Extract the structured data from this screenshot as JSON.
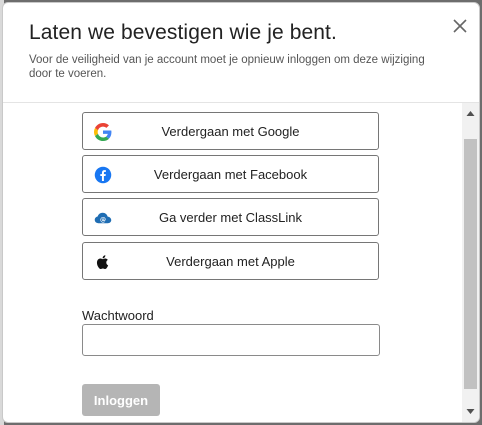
{
  "dialog": {
    "title": "Laten we bevestigen wie je bent.",
    "subtitle": "Voor de veiligheid van je account moet je opnieuw inloggen om deze wijziging door te voeren."
  },
  "providers": [
    {
      "label": "Verdergaan met Google",
      "icon": "google-icon"
    },
    {
      "label": "Verdergaan met Facebook",
      "icon": "facebook-icon"
    },
    {
      "label": "Ga verder met ClassLink",
      "icon": "classlink-icon"
    },
    {
      "label": "Verdergaan met Apple",
      "icon": "apple-icon"
    }
  ],
  "password": {
    "label": "Wachtwoord",
    "value": "",
    "placeholder": ""
  },
  "login": {
    "label": "Inloggen"
  },
  "colors": {
    "facebook": "#1877f2",
    "classlink": "#1f6db3",
    "disabled_button": "#b5b5b5"
  }
}
